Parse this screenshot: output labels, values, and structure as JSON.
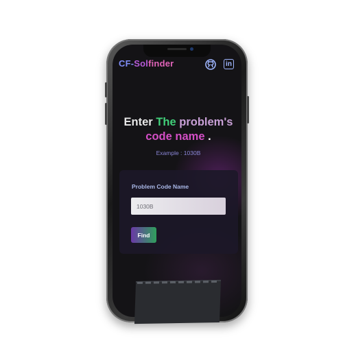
{
  "header": {
    "brand_part1": "CF-",
    "brand_part2": "Sol",
    "brand_part3": "finder",
    "github_icon": "github-icon",
    "linkedin_icon": "linkedin-icon",
    "linkedin_glyph": "in"
  },
  "hero": {
    "word1": "Enter",
    "word2": "The",
    "word3": "problem's",
    "word4": "code name",
    "word5": ".",
    "example": "Example : 1030B"
  },
  "form": {
    "label": "Problem Code Name",
    "placeholder": "1030B",
    "value": "",
    "button": "Find"
  },
  "colors": {
    "background": "#141316",
    "accent_purple": "#6a38a6",
    "accent_green": "#2fa05c",
    "brand_blue": "#7f8df5",
    "brand_pink": "#e063b8"
  }
}
